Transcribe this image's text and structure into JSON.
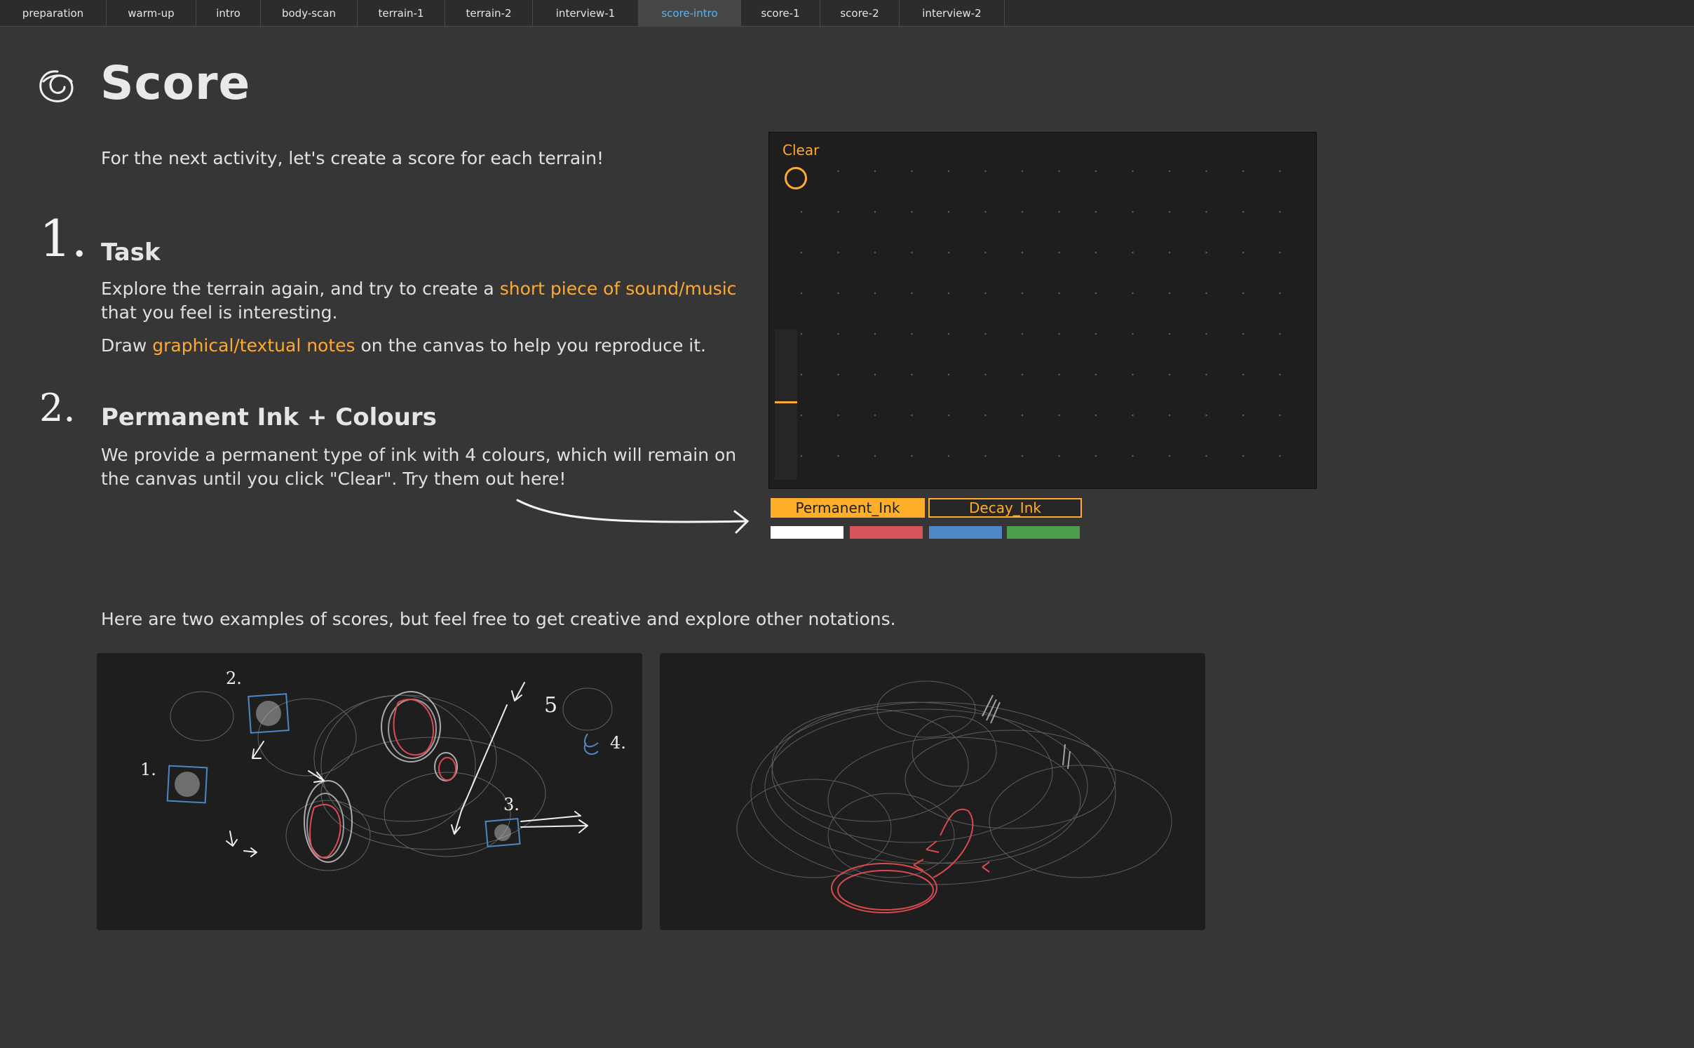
{
  "tabs": [
    {
      "label": "preparation",
      "active": false
    },
    {
      "label": "warm-up",
      "active": false
    },
    {
      "label": "intro",
      "active": false
    },
    {
      "label": "body-scan",
      "active": false
    },
    {
      "label": "terrain-1",
      "active": false
    },
    {
      "label": "terrain-2",
      "active": false
    },
    {
      "label": "interview-1",
      "active": false
    },
    {
      "label": "score-intro",
      "active": true
    },
    {
      "label": "score-1",
      "active": false
    },
    {
      "label": "score-2",
      "active": false
    },
    {
      "label": "interview-2",
      "active": false
    }
  ],
  "page": {
    "title": "Score",
    "intro": "For the next activity, let's create a score for each terrain!"
  },
  "section1": {
    "number": "1.",
    "heading": "Task",
    "line1_pre": "Explore the terrain again, and try to create a ",
    "line1_highlight": "short piece of sound/music",
    "line2": "that you feel is interesting.",
    "line3_pre": "Draw ",
    "line3_highlight": "graphical/textual notes",
    "line3_post": " on the canvas to help you reproduce it."
  },
  "section2": {
    "number": "2.",
    "heading": "Permanent Ink + Colours",
    "line1": "We provide a permanent type of ink with 4 colours, which will remain on",
    "line2": "the canvas until you click \"Clear\".  Try them out here!"
  },
  "canvas": {
    "clear_label": "Clear",
    "slider_level": 0.52
  },
  "ink": {
    "permanent_label": "Permanent_Ink",
    "decay_label": "Decay_Ink",
    "selected": "Permanent_Ink"
  },
  "colors": {
    "accent": "#ffa92e",
    "active_tab_text": "#5ab4ee",
    "swatches": [
      "#ffffff",
      "#d9535a",
      "#4f86c6",
      "#4e9c4e"
    ]
  },
  "examples": {
    "text": "Here are two examples of scores, but feel free to get creative and explore other notations.",
    "example1_marks": [
      "1.",
      "2.",
      "3.",
      "4.",
      "5"
    ]
  }
}
